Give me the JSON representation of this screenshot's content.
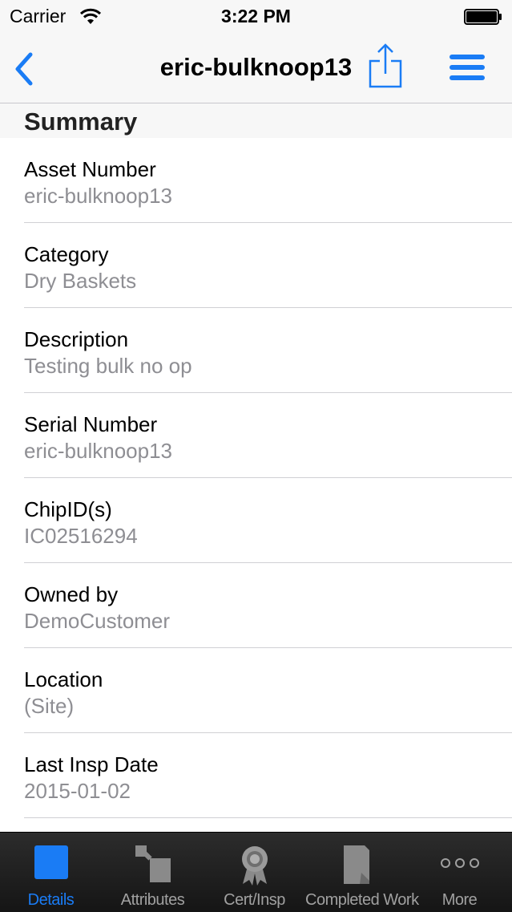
{
  "status_bar": {
    "carrier": "Carrier",
    "time": "3:22 PM"
  },
  "nav": {
    "title": "eric-bulknoop13",
    "back_icon": "chevron-left-icon",
    "share_icon": "share-icon",
    "menu_icon": "hamburger-menu-icon",
    "accent_color": "#1a7cf5"
  },
  "section": {
    "title": "Summary"
  },
  "fields": [
    {
      "label": "Asset Number",
      "value": "eric-bulknoop13"
    },
    {
      "label": "Category",
      "value": "Dry Baskets"
    },
    {
      "label": "Description",
      "value": "Testing bulk no op"
    },
    {
      "label": "Serial Number",
      "value": "eric-bulknoop13"
    },
    {
      "label": "ChipID(s)",
      "value": "IC02516294"
    },
    {
      "label": "Owned by",
      "value": "DemoCustomer"
    },
    {
      "label": "Location",
      "value": "(Site)"
    },
    {
      "label": "Last Insp Date",
      "value": "2015-01-02"
    }
  ],
  "tabs": [
    {
      "label": "Details",
      "icon": "details-square-icon",
      "active": true
    },
    {
      "label": "Attributes",
      "icon": "attributes-icon",
      "active": false
    },
    {
      "label": "Cert/Insp",
      "icon": "certificate-ribbon-icon",
      "active": false
    },
    {
      "label": "Completed Work",
      "icon": "completed-work-icon",
      "active": false
    },
    {
      "label": "More",
      "icon": "more-dots-icon",
      "active": false
    }
  ]
}
